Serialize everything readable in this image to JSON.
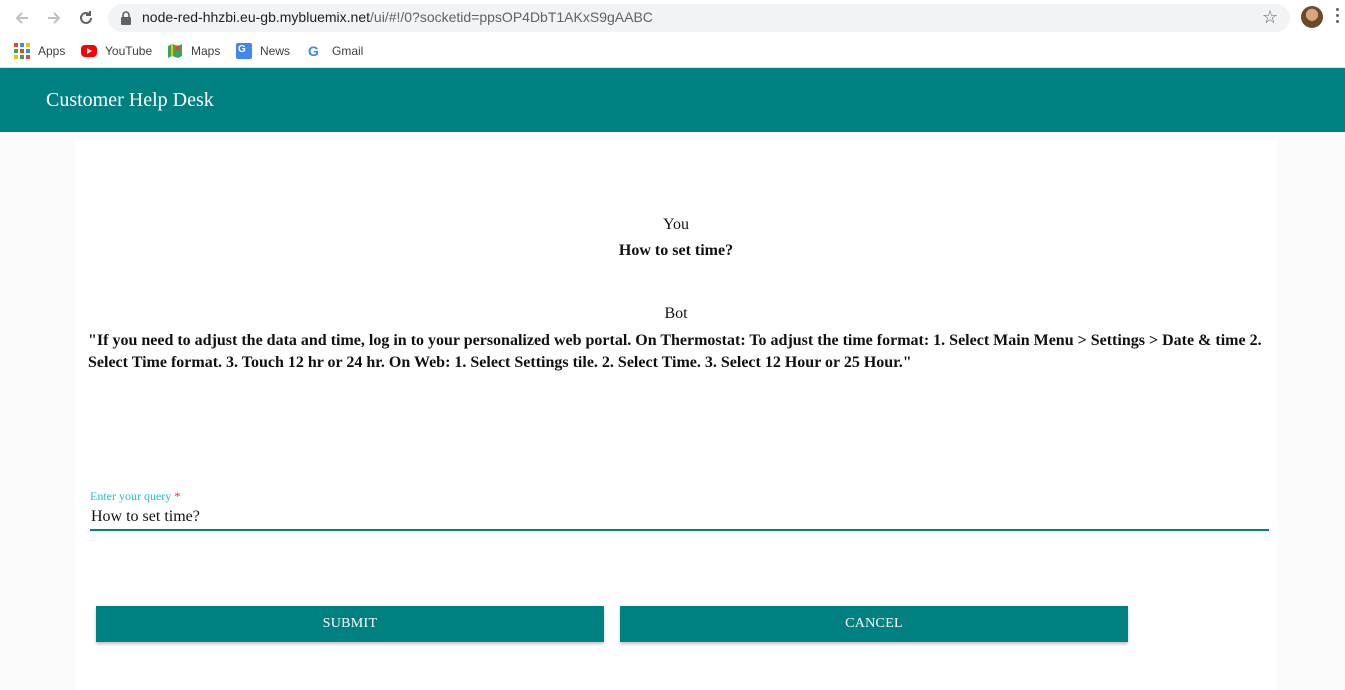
{
  "browser": {
    "url_host": "node-red-hhzbi.eu-gb.mybluemix.net",
    "url_path": "/ui/#!/0?socketid=ppsOP4DbT1AKxS9gAABC",
    "bookmarks": [
      {
        "label": "Apps",
        "icon": "apps-grid-icon"
      },
      {
        "label": "YouTube",
        "icon": "youtube-icon"
      },
      {
        "label": "Maps",
        "icon": "maps-icon"
      },
      {
        "label": "News",
        "icon": "news-icon"
      },
      {
        "label": "Gmail",
        "icon": "google-icon"
      }
    ]
  },
  "header": {
    "title": "Customer Help Desk",
    "color": "#008080"
  },
  "chat": {
    "user_sender": "You",
    "user_message": "How to set time?",
    "bot_sender": "Bot",
    "bot_message": "\"If you need to adjust the data and time, log in to your personalized web portal. On Thermostat: To adjust the time format: 1. Select Main Menu > Settings > Date & time 2. Select Time format. 3. Touch 12 hr or 24 hr. On Web: 1. Select Settings tile. 2. Select Time. 3. Select 12 Hour or 25 Hour.\""
  },
  "form": {
    "query_label": "Enter your query",
    "required_mark": "*",
    "query_value": "How to set time?",
    "submit_label": "SUBMIT",
    "cancel_label": "CANCEL"
  }
}
